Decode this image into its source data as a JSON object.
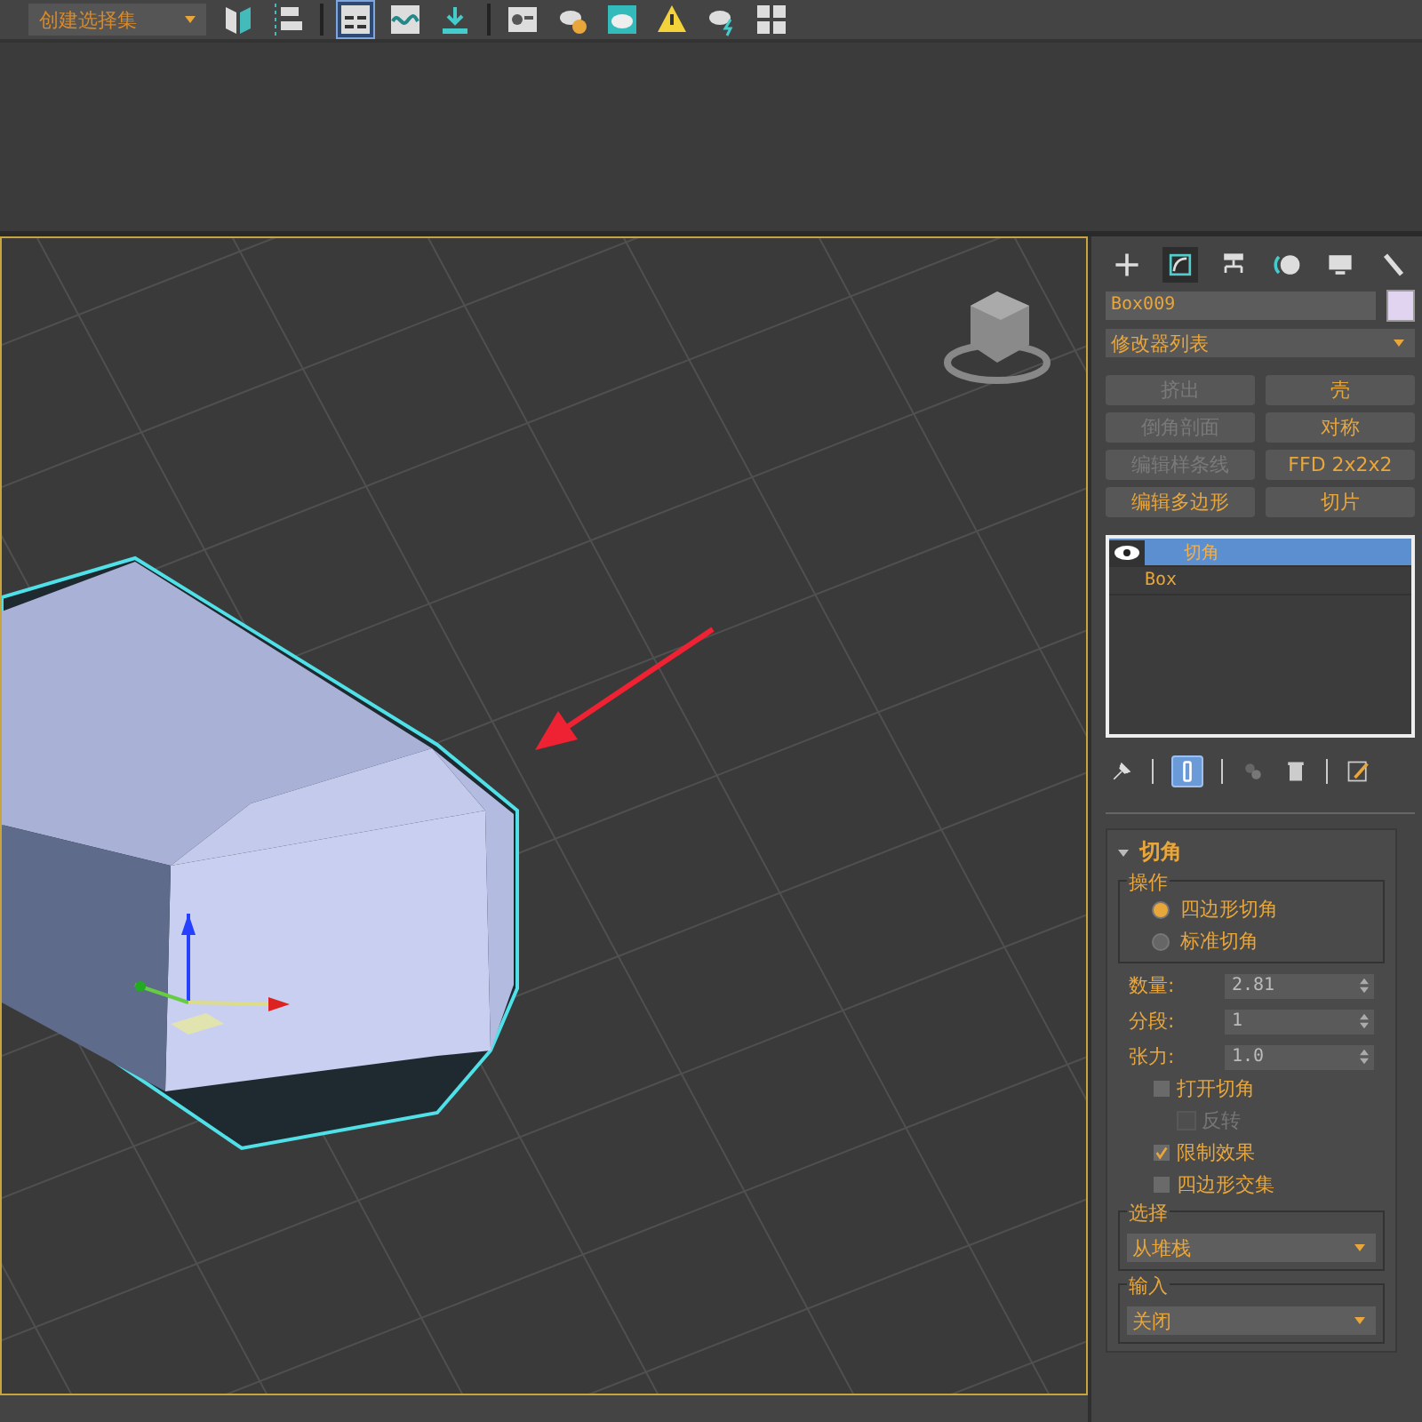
{
  "toolbar": {
    "selection_set": {
      "value": "创建选择集"
    }
  },
  "command_panel": {
    "tabs": [
      {
        "kind": "create",
        "selected": false
      },
      {
        "kind": "modify",
        "selected": true
      },
      {
        "kind": "hierarchy",
        "selected": false
      },
      {
        "kind": "motion",
        "selected": false
      },
      {
        "kind": "display",
        "selected": false
      },
      {
        "kind": "utilities",
        "selected": false
      }
    ],
    "object_name": "Box009",
    "modifier_list": {
      "value": "修改器列表"
    },
    "modifier_buttons": [
      {
        "label": "挤出",
        "disabled": true
      },
      {
        "label": "壳",
        "disabled": false
      },
      {
        "label": "倒角剖面",
        "disabled": true
      },
      {
        "label": "对称",
        "disabled": false
      },
      {
        "label": "编辑样条线",
        "disabled": true
      },
      {
        "label": "FFD 2x2x2",
        "disabled": false
      },
      {
        "label": "编辑多边形",
        "disabled": false
      },
      {
        "label": "切片",
        "disabled": false
      }
    ],
    "stack": [
      {
        "label": "切角",
        "selected": true
      },
      {
        "label": "Box",
        "selected": false
      }
    ],
    "rollout": {
      "title": "切角",
      "expanded": true,
      "operation": {
        "title": "操作",
        "options": [
          {
            "label": "四边形切角",
            "selected": true
          },
          {
            "label": "标准切角",
            "selected": false
          }
        ]
      },
      "fields": [
        {
          "label": "数量:",
          "value": "2.81"
        },
        {
          "label": "分段:",
          "value": "1"
        },
        {
          "label": "张力:",
          "value": "1.0"
        }
      ],
      "checkboxes": [
        {
          "label": "打开切角",
          "checked": false,
          "disabled": false,
          "children": [
            {
              "label": "反转",
              "checked": false,
              "disabled": true
            }
          ]
        },
        {
          "label": "限制效果",
          "checked": true,
          "disabled": false
        },
        {
          "label": "四边形交集",
          "checked": false,
          "disabled": false
        }
      ],
      "selection": {
        "title": "选择",
        "value": "从堆栈"
      },
      "input": {
        "title": "输入",
        "value": "关闭"
      }
    }
  }
}
